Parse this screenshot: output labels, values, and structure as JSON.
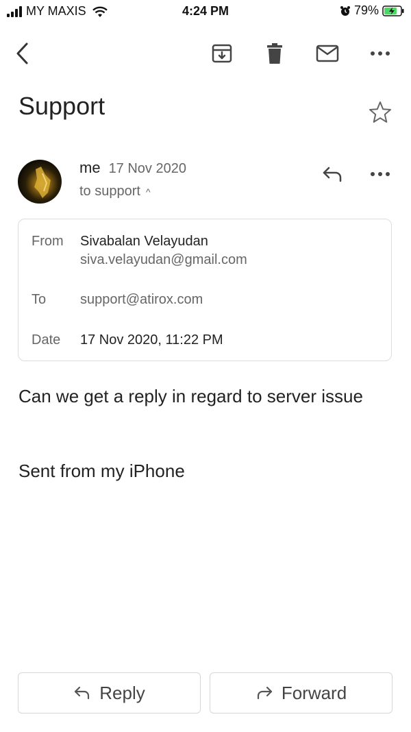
{
  "status_bar": {
    "carrier": "MY MAXIS",
    "time": "4:24 PM",
    "battery_percent": "79%",
    "icons": [
      "signal-icon",
      "wifi-icon",
      "alarm-icon",
      "battery-charging-icon"
    ]
  },
  "toolbar": {
    "icons": [
      "back-icon",
      "archive-icon",
      "trash-icon",
      "mail-icon",
      "more-horizontal-icon"
    ]
  },
  "email": {
    "subject": "Support",
    "sender": "me",
    "date": "17 Nov 2020",
    "recipients_summary": "to support",
    "details": {
      "from_label": "From",
      "from_name": "Sivabalan Velayudan",
      "from_email": "siva.velayudan@gmail.com",
      "to_label": "To",
      "to_value": "support@atirox.com",
      "date_label": "Date",
      "date_value": "17 Nov 2020, 11:22 PM"
    },
    "body": [
      "Can we get a reply in regard to server issue",
      "Sent from my iPhone"
    ]
  },
  "actions": {
    "reply_label": "Reply",
    "forward_label": "Forward"
  },
  "colors": {
    "text_primary": "#222222",
    "text_secondary": "#666666",
    "border": "#dcdcdc",
    "battery_charging": "#4cd964"
  }
}
